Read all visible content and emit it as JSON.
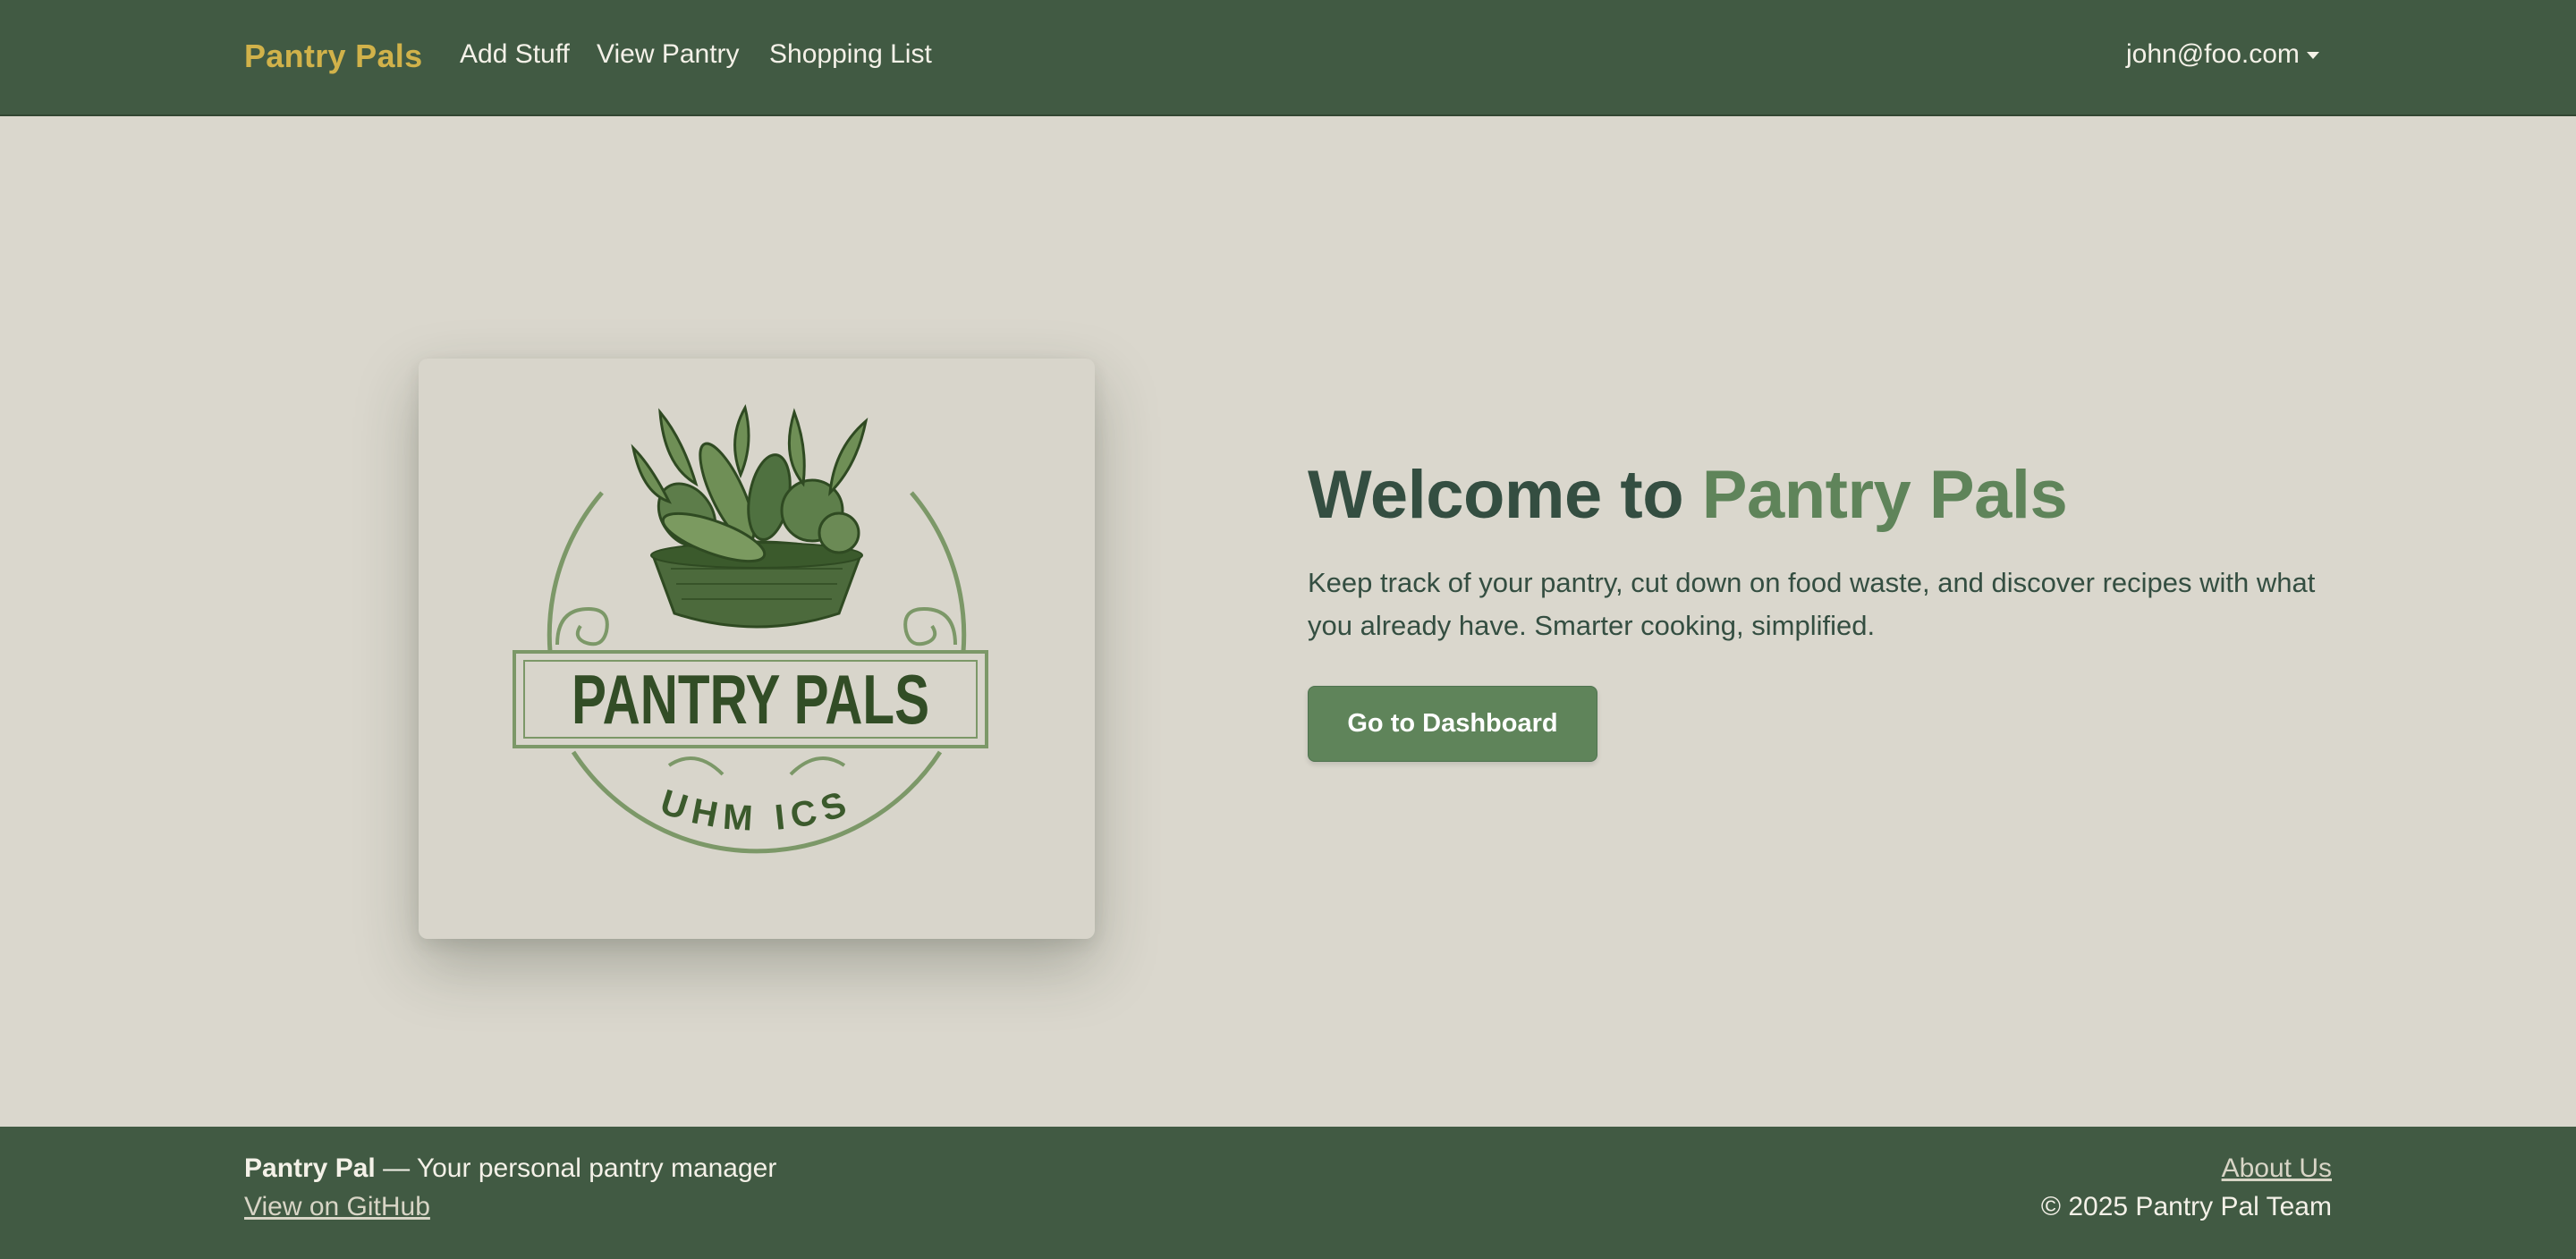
{
  "navbar": {
    "brand": "Pantry Pals",
    "links": [
      {
        "label": "Add Stuff"
      },
      {
        "label": "View Pantry"
      },
      {
        "label": "Shopping List"
      }
    ],
    "user_email": "john@foo.com",
    "user_menu_icon": "caret-down-icon"
  },
  "hero": {
    "logo": {
      "banner_text": "PANTRY PALS",
      "arc_text": "UHM ICS",
      "icon": "vegetable-basket-icon"
    },
    "title_prefix": "Welcome to",
    "title_accent": "Pantry Pals",
    "subtitle": "Keep track of your pantry, cut down on food waste, and discover recipes with what you already have. Smarter cooking, simplified.",
    "cta_label": "Go to Dashboard"
  },
  "footer": {
    "app_name": "Pantry Pal",
    "tagline": "— Your personal pantry manager",
    "github_link": "View on GitHub",
    "about_link": "About Us",
    "copyright": "© 2025 Pantry Pal Team"
  },
  "colors": {
    "navbar_bg": "#415a43",
    "brand": "#d1b24a",
    "page_bg": "#dad7cd",
    "accent": "#5f845a",
    "heading": "#344e41"
  }
}
